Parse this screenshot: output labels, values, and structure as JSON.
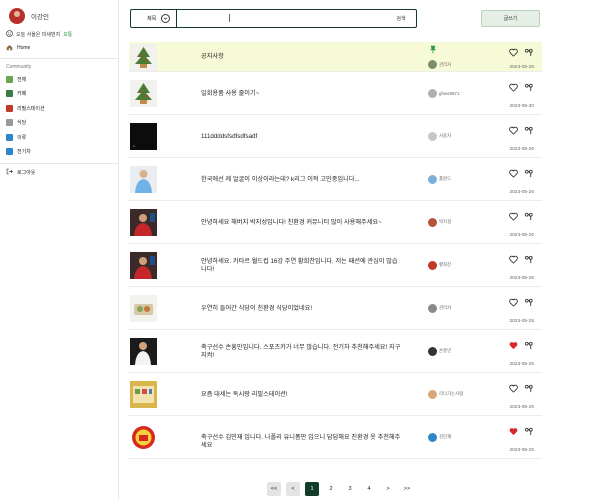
{
  "sidebar": {
    "user_name": "이강인",
    "dust_prefix": "오늘 서울은 미세먼지",
    "dust_status": "보통",
    "home_label": "Home",
    "section_label": "Community",
    "items": [
      {
        "label": "전체",
        "icon": "globe-icon",
        "color": "#6aa84f"
      },
      {
        "label": "카페",
        "icon": "cafe-icon",
        "color": "#3d7a45"
      },
      {
        "label": "리필스테이션",
        "icon": "refill-icon",
        "color": "#c0392b"
      },
      {
        "label": "식당",
        "icon": "restaurant-icon",
        "color": "#999999"
      },
      {
        "label": "의류",
        "icon": "clothing-icon",
        "color": "#2f86c9"
      },
      {
        "label": "전기차",
        "icon": "ev-car-icon",
        "color": "#2f86c9"
      }
    ],
    "logout_label": "로그아웃"
  },
  "search": {
    "select_label": "제목",
    "value": "",
    "button_label": "검색"
  },
  "write_button": "글쓰기",
  "posts": [
    {
      "title": "공지사항",
      "author": "관리자",
      "date": "2023-05-25",
      "liked": false,
      "pinned": true,
      "thumb": "plant",
      "avatar_color": "#7b8f6a"
    },
    {
      "title": "일회용품 사용 줄이기~",
      "author": "ghwo9671",
      "date": "2023-05-30",
      "liked": false,
      "pinned": false,
      "thumb": "plant",
      "avatar_color": "#b0b0b0"
    },
    {
      "title": "111ddddsfsdfsdfsadf",
      "author": "사용자",
      "date": "2023-05-26",
      "liked": false,
      "pinned": false,
      "thumb": "dark",
      "avatar_color": "#c7c7c7"
    },
    {
      "title": "한국에선 제 얼굴이 이상이라는데? k리그 이적 고민중입니다...",
      "author": "홀란드",
      "date": "2023-05-26",
      "liked": false,
      "pinned": false,
      "thumb": "player-blue",
      "avatar_color": "#7ab0d9"
    },
    {
      "title": "안녕하세요 해버지 박지성입니다! 친환경 커뮤니티 많이 사용해주세요~",
      "author": "박지성",
      "date": "2023-05-26",
      "liked": false,
      "pinned": false,
      "thumb": "player-red",
      "avatar_color": "#b5523a"
    },
    {
      "title": "안녕하세요. 카타르 월드컵 16강 주연 황희찬입니다. 저는 패션에 관심이 많습니다!",
      "author": "황희찬",
      "date": "2023-05-26",
      "liked": false,
      "pinned": false,
      "thumb": "player-red",
      "avatar_color": "#c0392b"
    },
    {
      "title": "우연히 들어간 식당이 친환경 식당이었네요!",
      "author": "관리자",
      "date": "2023-05-25",
      "liked": false,
      "pinned": false,
      "thumb": "food",
      "avatar_color": "#8a8a8a"
    },
    {
      "title": "축구선수 손흥민입니다. 스포츠카가 너무 많습니다. 전기차 추천해주세요! 지구지켜!",
      "author": "손흥민",
      "date": "2023-05-25",
      "liked": true,
      "pinned": false,
      "thumb": "player-white",
      "avatar_color": "#333333"
    },
    {
      "title": "요즘 대세는 독시랑 리필스테이션!",
      "author": "리나가는사람",
      "date": "2023-05-25",
      "liked": false,
      "pinned": false,
      "thumb": "shop",
      "avatar_color": "#d9a87a"
    },
    {
      "title": "축구선수 김민재 입니다. 나폴리 유니폼만 입으니 답답해요 친환경 옷 추천해주세요",
      "author": "김민재",
      "date": "2023-05-25",
      "liked": true,
      "pinned": false,
      "thumb": "crest",
      "avatar_color": "#2f86c9"
    }
  ],
  "pagination": {
    "first": "<<",
    "prev": "<",
    "pages": [
      "1",
      "2",
      "3",
      "4"
    ],
    "current": "1",
    "next": ">",
    "last": ">>"
  },
  "colors": {
    "accent": "#113c2a",
    "pinned_bg": "#f7fad7",
    "heart_liked": "#d42a2a",
    "write_btn_bg": "#e6efe6"
  }
}
